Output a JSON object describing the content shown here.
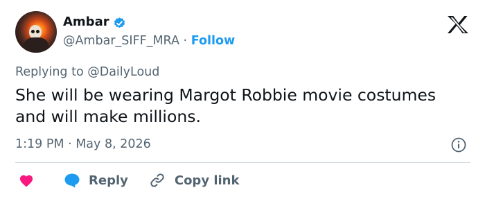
{
  "author": {
    "display_name": "Ambar",
    "handle": "@Ambar_SIFF_MRA",
    "separator": "·",
    "follow_label": "Follow"
  },
  "tweet": {
    "reply_to": "Replying to @DailyLoud",
    "text": "She will be wearing Margot Robbie movie costumes and will make millions.",
    "timestamp": "1:19 PM · May 8, 2026"
  },
  "actions": {
    "reply_label": "Reply",
    "copy_link_label": "Copy link"
  },
  "icons": {
    "verified": "verified-badge-icon",
    "logo": "x-logo-icon",
    "info": "info-icon",
    "like": "heart-icon",
    "reply": "speech-bubble-icon",
    "copy": "link-icon"
  },
  "colors": {
    "accent": "#1d9bf0",
    "like": "#f91880",
    "text": "#0f1419",
    "secondary": "#536471",
    "divider": "#cfd9de"
  }
}
